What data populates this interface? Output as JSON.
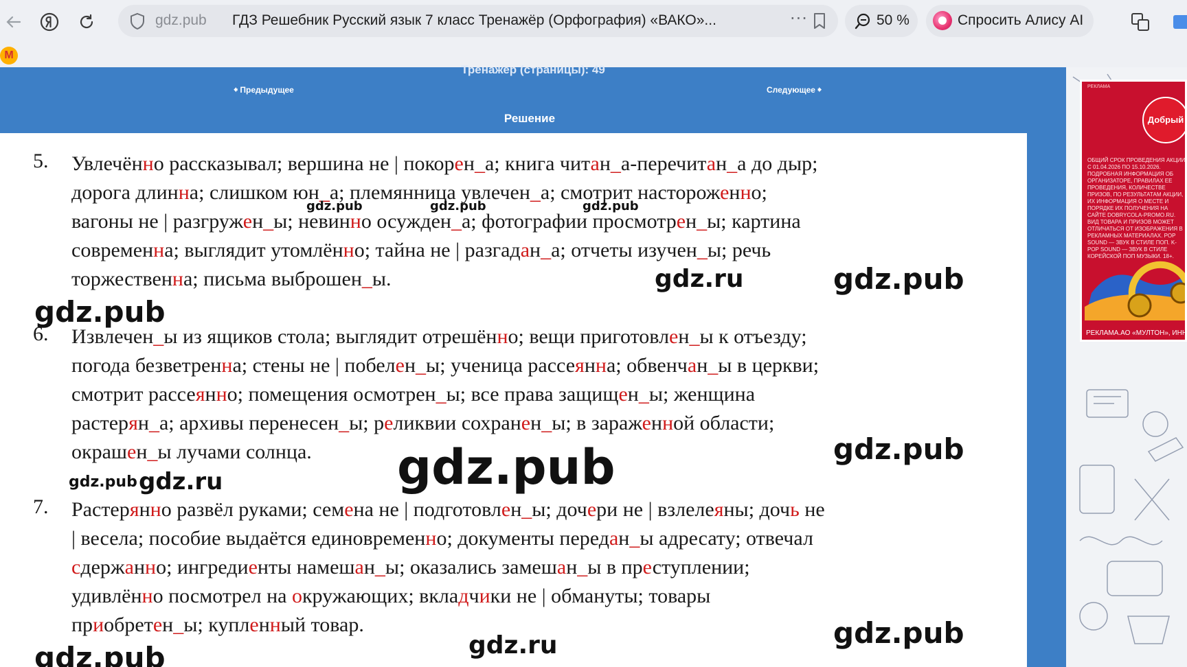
{
  "browser": {
    "domain": "gdz.pub",
    "tab_title": "ГДЗ Решебник Русский язык 7 класс Тренажёр (Орфография) «ВАКО»...",
    "dots": "···",
    "zoom": "50 %",
    "alice_label": "Спросить Алису AI",
    "extension_letter": "M"
  },
  "header": {
    "crumb": "Тренажер (страницы): 49",
    "prev": "Предыдущее",
    "next": "Следующее",
    "solution_title": "Решение"
  },
  "items": [
    {
      "num": "5.",
      "lines": [
        [
          [
            "Увлечён",
            0
          ],
          [
            "н",
            1
          ],
          [
            "о рассказывал; вершина не | покор",
            0
          ],
          [
            "е",
            1
          ],
          [
            "н",
            0
          ],
          [
            "_",
            1
          ],
          [
            "а; книга чит",
            0
          ],
          [
            "а",
            1
          ],
          [
            "н",
            0
          ],
          [
            "_",
            1
          ],
          [
            "а-перечит",
            0
          ],
          [
            "а",
            1
          ],
          [
            "н",
            0
          ],
          [
            "_",
            1
          ],
          [
            "а до дыр;",
            0
          ]
        ],
        [
          [
            "дорога длин",
            0
          ],
          [
            "н",
            1
          ],
          [
            "а; слишком юн",
            0
          ],
          [
            "_",
            1
          ],
          [
            "а; племянница увлечен",
            0
          ],
          [
            "_",
            1
          ],
          [
            "а; смотрит насторож",
            0
          ],
          [
            "е",
            1
          ],
          [
            "н",
            0
          ],
          [
            "н",
            1
          ],
          [
            "о;",
            0
          ]
        ],
        [
          [
            "вагоны не | разгруж",
            0
          ],
          [
            "е",
            1
          ],
          [
            "н",
            0
          ],
          [
            "_",
            1
          ],
          [
            "ы; невин",
            0
          ],
          [
            "н",
            1
          ],
          [
            "о осужден",
            0
          ],
          [
            "_",
            1
          ],
          [
            "а; фотографии просмотр",
            0
          ],
          [
            "е",
            1
          ],
          [
            "н",
            0
          ],
          [
            "_",
            1
          ],
          [
            "ы; картина",
            0
          ]
        ],
        [
          [
            "современ",
            0
          ],
          [
            "н",
            1
          ],
          [
            "а; выглядит утомлён",
            0
          ],
          [
            "н",
            1
          ],
          [
            "о; тайна не | разгад",
            0
          ],
          [
            "а",
            1
          ],
          [
            "н",
            0
          ],
          [
            "_",
            1
          ],
          [
            "а; отчеты изучен",
            0
          ],
          [
            "_",
            1
          ],
          [
            "ы; речь",
            0
          ]
        ],
        [
          [
            "торжествен",
            0
          ],
          [
            "н",
            1
          ],
          [
            "а; письма выброшен",
            0
          ],
          [
            "_",
            1
          ],
          [
            "ы.",
            0
          ]
        ]
      ]
    },
    {
      "num": "6.",
      "lines": [
        [
          [
            "Извлечен",
            0
          ],
          [
            "_",
            1
          ],
          [
            "ы из ящиков стола; выглядит отрешён",
            0
          ],
          [
            "н",
            1
          ],
          [
            "о; вещи приготовл",
            0
          ],
          [
            "е",
            1
          ],
          [
            "н",
            0
          ],
          [
            "_",
            1
          ],
          [
            "ы к отъезду;",
            0
          ]
        ],
        [
          [
            "погода безветрен",
            0
          ],
          [
            "н",
            1
          ],
          [
            "а; стены не | побел",
            0
          ],
          [
            "е",
            1
          ],
          [
            "н",
            0
          ],
          [
            "_",
            1
          ],
          [
            "ы; ученица рассе",
            0
          ],
          [
            "я",
            1
          ],
          [
            "н",
            0
          ],
          [
            "н",
            1
          ],
          [
            "а; обвенч",
            0
          ],
          [
            "а",
            1
          ],
          [
            "н",
            0
          ],
          [
            "_",
            1
          ],
          [
            "ы в церкви;",
            0
          ]
        ],
        [
          [
            "смотрит рассе",
            0
          ],
          [
            "я",
            1
          ],
          [
            "н",
            0
          ],
          [
            "н",
            1
          ],
          [
            "о; помещения осмотрен",
            0
          ],
          [
            "_",
            1
          ],
          [
            "ы; все права защищ",
            0
          ],
          [
            "е",
            1
          ],
          [
            "н",
            0
          ],
          [
            "_",
            1
          ],
          [
            "ы; женщина",
            0
          ]
        ],
        [
          [
            "растер",
            0
          ],
          [
            "я",
            1
          ],
          [
            "н",
            0
          ],
          [
            "_",
            1
          ],
          [
            "а; архивы перенесен",
            0
          ],
          [
            "_",
            1
          ],
          [
            "ы; р",
            0
          ],
          [
            "е",
            1
          ],
          [
            "ликвии сохран",
            0
          ],
          [
            "е",
            1
          ],
          [
            "н",
            0
          ],
          [
            "_",
            1
          ],
          [
            "ы; в зараж",
            0
          ],
          [
            "е",
            1
          ],
          [
            "н",
            0
          ],
          [
            "н",
            1
          ],
          [
            "ой области;",
            0
          ]
        ],
        [
          [
            "окраш",
            0
          ],
          [
            "е",
            1
          ],
          [
            "н",
            0
          ],
          [
            "_",
            1
          ],
          [
            "ы лучами солнца.",
            0
          ]
        ]
      ]
    },
    {
      "num": "7.",
      "lines": [
        [
          [
            "Растер",
            0
          ],
          [
            "я",
            1
          ],
          [
            "н",
            0
          ],
          [
            "н",
            1
          ],
          [
            "о развёл руками; сем",
            0
          ],
          [
            "е",
            1
          ],
          [
            "на не | подготовл",
            0
          ],
          [
            "е",
            1
          ],
          [
            "н",
            0
          ],
          [
            "_",
            1
          ],
          [
            "ы; доч",
            0
          ],
          [
            "е",
            1
          ],
          [
            "ри не | взлеле",
            0
          ],
          [
            "я",
            1
          ],
          [
            "ны; доч",
            0
          ],
          [
            "ь",
            1
          ],
          [
            " не",
            0
          ]
        ],
        [
          [
            "| весела; пособие выдаётся единовремен",
            0
          ],
          [
            "н",
            1
          ],
          [
            "о; документы перед",
            0
          ],
          [
            "а",
            1
          ],
          [
            "н",
            0
          ],
          [
            "_",
            1
          ],
          [
            "ы адресату; отвечал",
            0
          ]
        ],
        [
          [
            "с",
            1
          ],
          [
            "держ",
            0
          ],
          [
            "а",
            1
          ],
          [
            "н",
            0
          ],
          [
            "н",
            1
          ],
          [
            "о; ингреди",
            0
          ],
          [
            "е",
            1
          ],
          [
            "нты намеш",
            0
          ],
          [
            "а",
            1
          ],
          [
            "н",
            0
          ],
          [
            "_",
            1
          ],
          [
            "ы; оказались замеш",
            0
          ],
          [
            "а",
            1
          ],
          [
            "н",
            0
          ],
          [
            "_",
            1
          ],
          [
            "ы в пр",
            0
          ],
          [
            "е",
            1
          ],
          [
            "ступлении;",
            0
          ]
        ],
        [
          [
            "удивлён",
            0
          ],
          [
            "н",
            1
          ],
          [
            "о посмотрел на ",
            0
          ],
          [
            "о",
            1
          ],
          [
            "кружающих; вкла",
            0
          ],
          [
            "д",
            1
          ],
          [
            "ч",
            0
          ],
          [
            "и",
            1
          ],
          [
            "ки не | обмануты; товары",
            0
          ]
        ],
        [
          [
            "пр",
            0
          ],
          [
            "и",
            1
          ],
          [
            "обрет",
            0
          ],
          [
            "е",
            1
          ],
          [
            "н",
            0
          ],
          [
            "_",
            1
          ],
          [
            "ы; купл",
            0
          ],
          [
            "е",
            1
          ],
          [
            "н",
            0
          ],
          [
            "н",
            1
          ],
          [
            "ый товар.",
            0
          ]
        ]
      ]
    }
  ],
  "watermarks": {
    "small": "gdz.pub",
    "ru": "gdz.ru",
    "pub": "gdz.pub",
    "big": "gdz.pub"
  },
  "ad": {
    "tag": "РЕКЛАМА",
    "brand": "Добрый",
    "body": "ОБЩИЙ СРОК ПРОВЕДЕНИЯ АКЦИИ С 01.04.2026 ПО 15.10.2026. ПОДРОБНАЯ ИНФОРМАЦИЯ ОБ ОРГАНИЗАТОРЕ, ПРАВИЛАХ ЕЕ ПРОВЕДЕНИЯ, КОЛИЧЕСТВЕ ПРИЗОВ, ПО РЕЗУЛЬТАТАМ АКЦИИ, ИХ ИНФОРМАЦИЯ О МЕСТЕ И ПОРЯДКЕ ИХ ПОЛУЧЕНИЯ НА САЙТЕ DOBRYCOLA-PROMO.RU. ВИД ТОВАРА И ПРИЗОВ МОЖЕТ ОТЛИЧАТЬСЯ ОТ ИЗОБРАЖЕНИЯ В РЕКЛАМНЫХ МАТЕРИАЛАХ. POP SOUND — ЗВУК В СТИЛЕ ПОП. K-POP SOUND — ЗВУК В СТИЛЕ КОРЕЙСКОЙ ПОП МУЗЫКИ. 18+.",
    "footer": "РЕКЛАМА.АО «МУЛТОН», ИНН"
  },
  "colors": {
    "accent_blue": "#3d7fc6",
    "red_highlight": "#d01b1b",
    "ad_red": "#c8102e"
  }
}
